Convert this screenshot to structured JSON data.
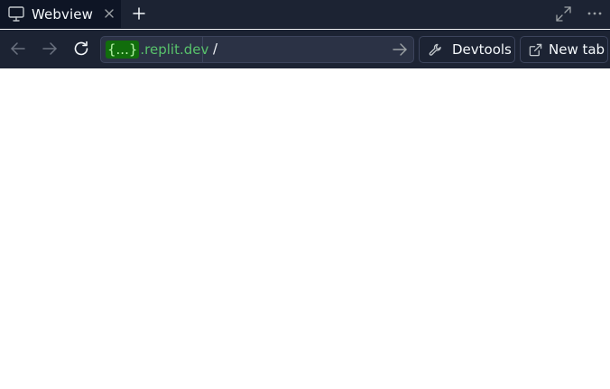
{
  "tab": {
    "title": "Webview",
    "icon": "monitor-icon"
  },
  "url_bar": {
    "host_token": "{...}",
    "host_suffix": ".replit.dev",
    "path": "/"
  },
  "buttons": {
    "devtools_label": "Devtools",
    "new_tab_label": "New tab"
  },
  "colors": {
    "chrome_bg": "#1c2333",
    "active_tab_bg": "#0e1525",
    "url_field_bg": "#2b3245",
    "host_green": "#58c26b",
    "token_bg": "#116d0c",
    "border": "#3c445c"
  }
}
